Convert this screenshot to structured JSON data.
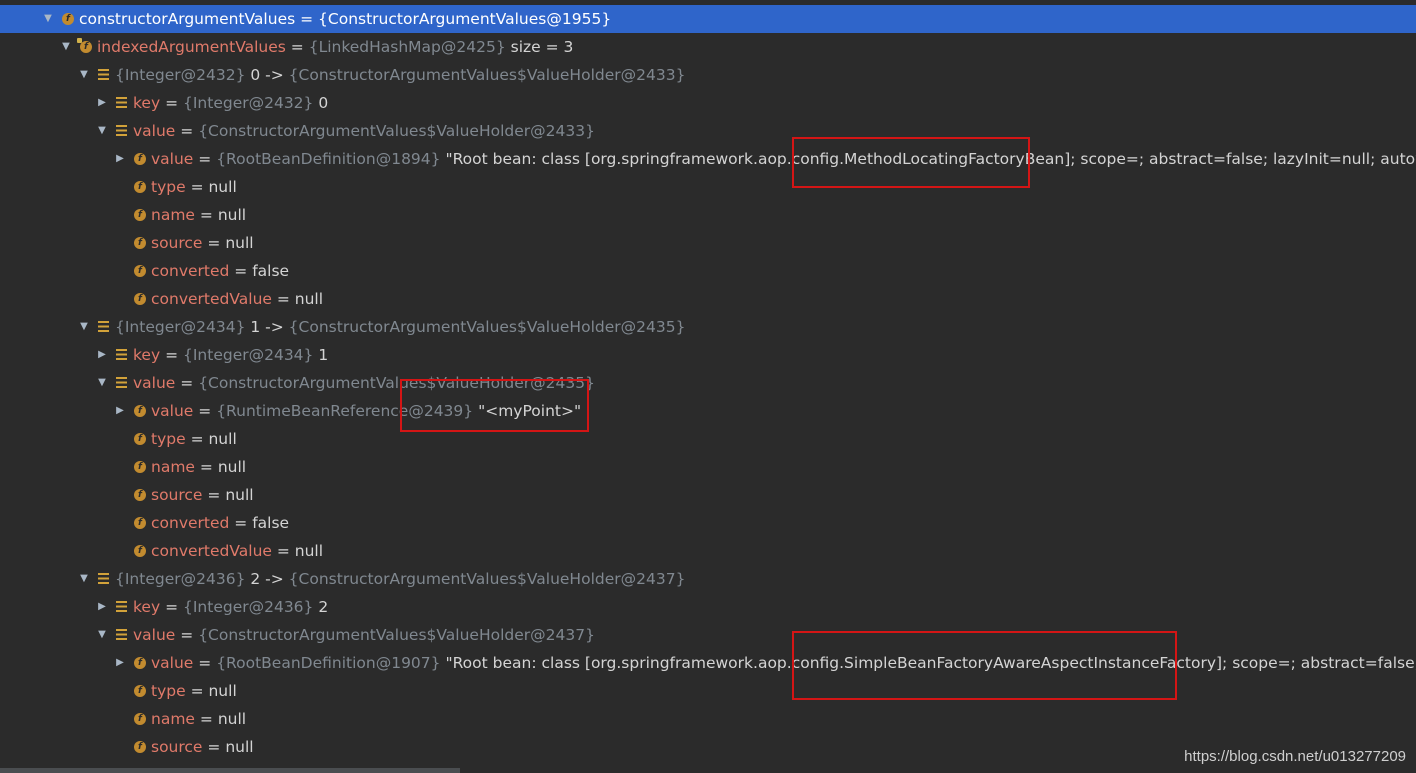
{
  "rows": [
    {
      "indent": 0,
      "arrow": "down",
      "icon": "field",
      "name": "constructorArgumentValues",
      "ref": "{ConstructorArgumentValues@1955}",
      "value": "",
      "selected": true
    },
    {
      "indent": 1,
      "arrow": "down",
      "icon": "field-lock",
      "name": "indexedArgumentValues",
      "ref": "{LinkedHashMap@2425}",
      "value": " size = 3"
    },
    {
      "indent": 2,
      "arrow": "down",
      "icon": "entry",
      "name": "",
      "ref": "{Integer@2432}",
      "value": "0 -> ",
      "ref2": "{ConstructorArgumentValues$ValueHolder@2433}"
    },
    {
      "indent": 3,
      "arrow": "right",
      "icon": "entry",
      "name": "key",
      "ref": "{Integer@2432}",
      "value": "0"
    },
    {
      "indent": 3,
      "arrow": "down",
      "icon": "entry",
      "name": "value",
      "ref": "{ConstructorArgumentValues$ValueHolder@2433}",
      "value": ""
    },
    {
      "indent": 4,
      "arrow": "right",
      "icon": "field",
      "name": "value",
      "ref": "{RootBeanDefinition@1894}",
      "value": "\"Root bean: class [org.springframework.aop.config.MethodLocatingFactoryBean]; scope=; abstract=false; lazyInit=null; autowireMo…"
    },
    {
      "indent": 4,
      "arrow": "",
      "icon": "field",
      "name": "type",
      "ref": "",
      "value": "null"
    },
    {
      "indent": 4,
      "arrow": "",
      "icon": "field",
      "name": "name",
      "ref": "",
      "value": "null"
    },
    {
      "indent": 4,
      "arrow": "",
      "icon": "field",
      "name": "source",
      "ref": "",
      "value": "null"
    },
    {
      "indent": 4,
      "arrow": "",
      "icon": "field",
      "name": "converted",
      "ref": "",
      "value": "false"
    },
    {
      "indent": 4,
      "arrow": "",
      "icon": "field",
      "name": "convertedValue",
      "ref": "",
      "value": "null"
    },
    {
      "indent": 2,
      "arrow": "down",
      "icon": "entry",
      "name": "",
      "ref": "{Integer@2434}",
      "value": "1 -> ",
      "ref2": "{ConstructorArgumentValues$ValueHolder@2435}"
    },
    {
      "indent": 3,
      "arrow": "right",
      "icon": "entry",
      "name": "key",
      "ref": "{Integer@2434}",
      "value": "1"
    },
    {
      "indent": 3,
      "arrow": "down",
      "icon": "entry",
      "name": "value",
      "ref": "{ConstructorArgumentValues$ValueHolder@2435}",
      "value": ""
    },
    {
      "indent": 4,
      "arrow": "right",
      "icon": "field",
      "name": "value",
      "ref": "{RuntimeBeanReference@2439}",
      "value": "\"<myPoint>\""
    },
    {
      "indent": 4,
      "arrow": "",
      "icon": "field",
      "name": "type",
      "ref": "",
      "value": "null"
    },
    {
      "indent": 4,
      "arrow": "",
      "icon": "field",
      "name": "name",
      "ref": "",
      "value": "null"
    },
    {
      "indent": 4,
      "arrow": "",
      "icon": "field",
      "name": "source",
      "ref": "",
      "value": "null"
    },
    {
      "indent": 4,
      "arrow": "",
      "icon": "field",
      "name": "converted",
      "ref": "",
      "value": "false"
    },
    {
      "indent": 4,
      "arrow": "",
      "icon": "field",
      "name": "convertedValue",
      "ref": "",
      "value": "null"
    },
    {
      "indent": 2,
      "arrow": "down",
      "icon": "entry",
      "name": "",
      "ref": "{Integer@2436}",
      "value": "2 -> ",
      "ref2": "{ConstructorArgumentValues$ValueHolder@2437}"
    },
    {
      "indent": 3,
      "arrow": "right",
      "icon": "entry",
      "name": "key",
      "ref": "{Integer@2436}",
      "value": "2"
    },
    {
      "indent": 3,
      "arrow": "down",
      "icon": "entry",
      "name": "value",
      "ref": "{ConstructorArgumentValues$ValueHolder@2437}",
      "value": ""
    },
    {
      "indent": 4,
      "arrow": "right",
      "icon": "field",
      "name": "value",
      "ref": "{RootBeanDefinition@1907}",
      "value": "\"Root bean: class [org.springframework.aop.config.SimpleBeanFactoryAwareAspectInstanceFactory]; scope=; abstract=false; lazyIn…"
    },
    {
      "indent": 4,
      "arrow": "",
      "icon": "field",
      "name": "type",
      "ref": "",
      "value": "null"
    },
    {
      "indent": 4,
      "arrow": "",
      "icon": "field",
      "name": "name",
      "ref": "",
      "value": "null"
    },
    {
      "indent": 4,
      "arrow": "",
      "icon": "field",
      "name": "source",
      "ref": "",
      "value": "null"
    }
  ],
  "watermark": "https://blog.csdn.net/u013277209",
  "colors": {
    "background": "#2b2b2b",
    "selection": "#2f65ca",
    "field_name": "#e07a6a",
    "reference": "#808890",
    "highlight_box": "#d41515"
  }
}
